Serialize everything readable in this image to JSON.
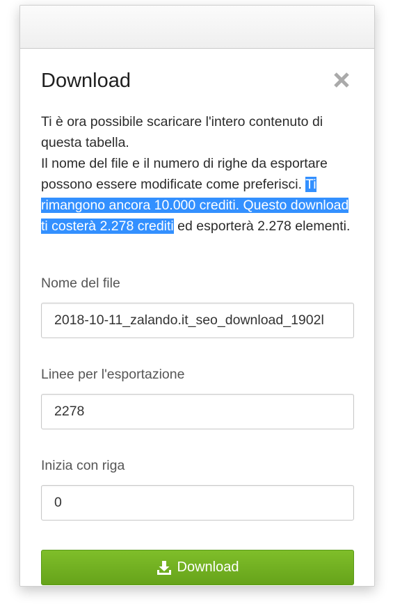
{
  "dialog": {
    "title": "Download",
    "close_icon": "close-icon",
    "description_plain": "Ti è ora possibile scaricare l'intero contenuto di questa tabella.",
    "description_line2_before": "Il nome del file e il numero di righe da esportare possono essere modificate come preferisci. ",
    "description_highlighted": "Ti rimangono ancora 10.000 crediti. Questo download ti costerà 2.278 crediti",
    "description_after": " ed esporterà 2.278 elementi."
  },
  "fields": {
    "filename": {
      "label": "Nome del file",
      "value": "2018-10-11_zalando.it_seo_download_1902l"
    },
    "lines": {
      "label": "Linee per l'esportazione",
      "value": "2278"
    },
    "start_row": {
      "label": "Inizia con riga",
      "value": "0"
    }
  },
  "button": {
    "label": "Download",
    "icon": "download-icon",
    "color": "#72b022"
  },
  "colors": {
    "highlight": "#3390ff"
  }
}
